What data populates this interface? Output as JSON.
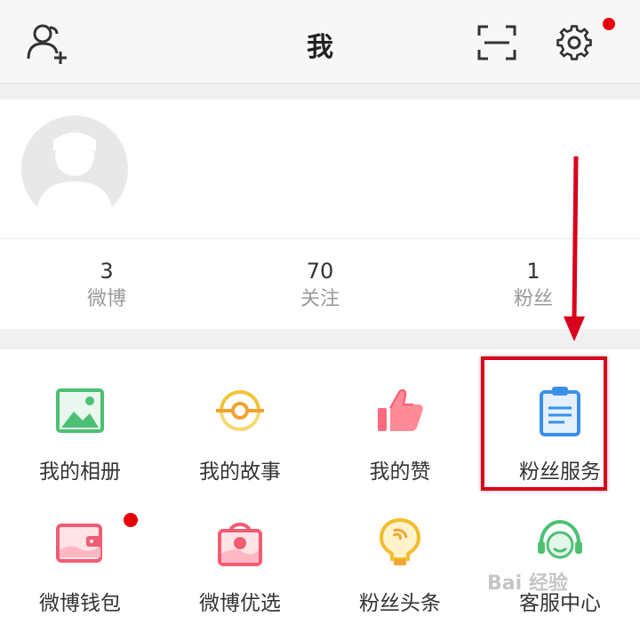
{
  "header": {
    "title": "我"
  },
  "stats": [
    {
      "value": "3",
      "label": "微博"
    },
    {
      "value": "70",
      "label": "关注"
    },
    {
      "value": "1",
      "label": "粉丝"
    }
  ],
  "grid": [
    {
      "label": "我的相册",
      "icon": "photo-album-icon"
    },
    {
      "label": "我的故事",
      "icon": "story-icon"
    },
    {
      "label": "我的赞",
      "icon": "thumbs-up-icon"
    },
    {
      "label": "粉丝服务",
      "icon": "clipboard-icon"
    },
    {
      "label": "微博钱包",
      "icon": "wallet-icon"
    },
    {
      "label": "微博优选",
      "icon": "shopping-bag-icon"
    },
    {
      "label": "粉丝头条",
      "icon": "headline-bulb-icon"
    },
    {
      "label": "客服中心",
      "icon": "headset-icon"
    }
  ],
  "colors": {
    "notification_dot": "#e7000b",
    "highlight_box": "#d9001b",
    "annotation_arrow": "#d9001b"
  },
  "watermark": "Bai 经验"
}
